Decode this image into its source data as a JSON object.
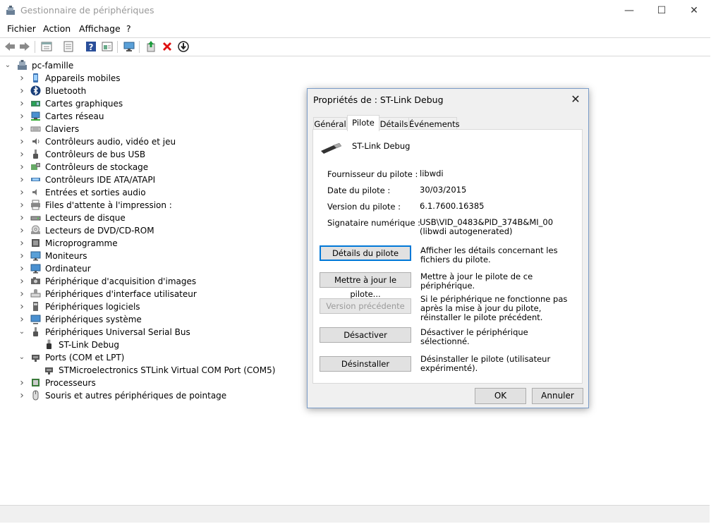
{
  "window": {
    "title": "Gestionnaire de périphériques",
    "minimize": "—",
    "maximize": "☐",
    "close": "✕"
  },
  "menu": [
    "Fichier",
    "Action",
    "Affichage",
    "?"
  ],
  "toolbar_icons": [
    "back-icon",
    "forward-icon",
    "properties-icon",
    "list-icon",
    "help-icon",
    "view-icon",
    "monitor-icon",
    "update-driver-icon",
    "remove-icon",
    "download-icon"
  ],
  "tree": {
    "root": "pc-famille",
    "items": [
      {
        "label": "Appareils mobiles",
        "icon": "mobile-device-icon",
        "state": "collapsed",
        "level": 1
      },
      {
        "label": "Bluetooth",
        "icon": "bluetooth-icon",
        "state": "collapsed",
        "level": 1
      },
      {
        "label": "Cartes graphiques",
        "icon": "display-adapter-icon",
        "state": "collapsed",
        "level": 1
      },
      {
        "label": "Cartes réseau",
        "icon": "network-adapter-icon",
        "state": "collapsed",
        "level": 1
      },
      {
        "label": "Claviers",
        "icon": "keyboard-icon",
        "state": "collapsed",
        "level": 1
      },
      {
        "label": "Contrôleurs audio, vidéo et jeu",
        "icon": "audio-icon",
        "state": "collapsed",
        "level": 1
      },
      {
        "label": "Contrôleurs de bus USB",
        "icon": "usb-controller-icon",
        "state": "collapsed",
        "level": 1
      },
      {
        "label": "Contrôleurs de stockage",
        "icon": "storage-controller-icon",
        "state": "collapsed",
        "level": 1
      },
      {
        "label": "Contrôleurs IDE ATA/ATAPI",
        "icon": "ide-icon",
        "state": "collapsed",
        "level": 1
      },
      {
        "label": "Entrées et sorties audio",
        "icon": "speaker-icon",
        "state": "collapsed",
        "level": 1
      },
      {
        "label": "Files d'attente à l'impression :",
        "icon": "printer-icon",
        "state": "collapsed",
        "level": 1
      },
      {
        "label": "Lecteurs de disque",
        "icon": "disk-drive-icon",
        "state": "collapsed",
        "level": 1
      },
      {
        "label": "Lecteurs de DVD/CD-ROM",
        "icon": "dvd-icon",
        "state": "collapsed",
        "level": 1
      },
      {
        "label": "Microprogramme",
        "icon": "firmware-icon",
        "state": "collapsed",
        "level": 1
      },
      {
        "label": "Moniteurs",
        "icon": "monitor-icon",
        "state": "collapsed",
        "level": 1
      },
      {
        "label": "Ordinateur",
        "icon": "computer-icon",
        "state": "collapsed",
        "level": 1
      },
      {
        "label": "Périphérique d'acquisition d'images",
        "icon": "camera-icon",
        "state": "collapsed",
        "level": 1
      },
      {
        "label": "Périphériques d'interface utilisateur",
        "icon": "hid-icon",
        "state": "collapsed",
        "level": 1
      },
      {
        "label": "Périphériques logiciels",
        "icon": "software-device-icon",
        "state": "collapsed",
        "level": 1
      },
      {
        "label": "Périphériques système",
        "icon": "system-device-icon",
        "state": "collapsed",
        "level": 1
      },
      {
        "label": "Périphériques Universal Serial Bus",
        "icon": "usb-device-icon",
        "state": "expanded",
        "level": 1
      },
      {
        "label": "ST-Link Debug",
        "icon": "usb-plug-icon",
        "state": "none",
        "level": 2
      },
      {
        "label": "Ports (COM et LPT)",
        "icon": "port-icon",
        "state": "expanded",
        "level": 1
      },
      {
        "label": "STMicroelectronics STLink Virtual COM Port (COM5)",
        "icon": "port-icon",
        "state": "none",
        "level": 2
      },
      {
        "label": "Processeurs",
        "icon": "processor-icon",
        "state": "collapsed",
        "level": 1
      },
      {
        "label": "Souris et autres périphériques de pointage",
        "icon": "mouse-icon",
        "state": "collapsed",
        "level": 1
      }
    ]
  },
  "dialog": {
    "title": "Propriétés de : ST-Link Debug",
    "close": "✕",
    "tabs": [
      "Général",
      "Pilote",
      "Détails",
      "Événements"
    ],
    "active_tab": "Pilote",
    "device_name": "ST-Link Debug",
    "info": [
      {
        "label": "Fournisseur du pilote :",
        "value": "libwdi"
      },
      {
        "label": "Date du pilote :",
        "value": "30/03/2015"
      },
      {
        "label": "Version du pilote :",
        "value": "6.1.7600.16385"
      },
      {
        "label": "Signataire numérique :",
        "value": "USB\\VID_0483&PID_374B&MI_00 (libwdi autogenerated)"
      }
    ],
    "actions": [
      {
        "button": "Détails du pilote",
        "desc": "Afficher les détails concernant les fichiers du pilote.",
        "state": "default"
      },
      {
        "button": "Mettre à jour le pilote...",
        "desc": "Mettre à jour le pilote de ce périphérique.",
        "state": "normal"
      },
      {
        "button": "Version précédente",
        "desc": "Si le périphérique ne fonctionne pas après la mise à jour du pilote, réinstaller le pilote précédent.",
        "state": "disabled"
      },
      {
        "button": "Désactiver",
        "desc": "Désactiver le périphérique sélectionné.",
        "state": "normal"
      },
      {
        "button": "Désinstaller",
        "desc": "Désinstaller le pilote (utilisateur expérimenté).",
        "state": "normal"
      }
    ],
    "ok": "OK",
    "cancel": "Annuler"
  },
  "colors": {
    "accent": "#0078d7",
    "dialog_bg": "#f0f0f0",
    "disabled_text": "#9a9a9a",
    "remove_red": "#e01010"
  }
}
